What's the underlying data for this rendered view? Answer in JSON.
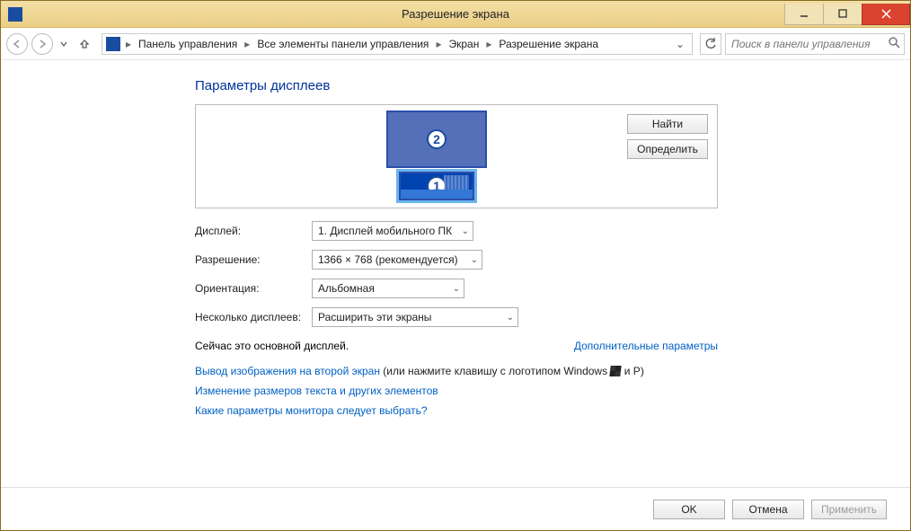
{
  "window": {
    "title": "Разрешение экрана"
  },
  "breadcrumb": {
    "items": [
      "Панель управления",
      "Все элементы панели управления",
      "Экран",
      "Разрешение экрана"
    ]
  },
  "search": {
    "placeholder": "Поиск в панели управления"
  },
  "page": {
    "heading": "Параметры дисплеев",
    "find_btn": "Найти",
    "identify_btn": "Определить",
    "monitor1_num": "1",
    "monitor2_num": "2",
    "labels": {
      "display": "Дисплей:",
      "resolution": "Разрешение:",
      "orientation": "Ориентация:",
      "multi": "Несколько дисплеев:"
    },
    "values": {
      "display": "1. Дисплей мобильного ПК",
      "resolution": "1366 × 768 (рекомендуется)",
      "orientation": "Альбомная",
      "multi": "Расширить эти экраны"
    },
    "status_text": "Сейчас это основной дисплей.",
    "advanced_link": "Дополнительные параметры",
    "link1a": "Вывод изображения на второй экран",
    "link1b": " (или нажмите клавишу с логотипом Windows ",
    "link1c": " и P)",
    "link2": "Изменение размеров текста и других элементов",
    "link3": "Какие параметры монитора следует выбрать?"
  },
  "footer": {
    "ok": "OK",
    "cancel": "Отмена",
    "apply": "Применить"
  }
}
